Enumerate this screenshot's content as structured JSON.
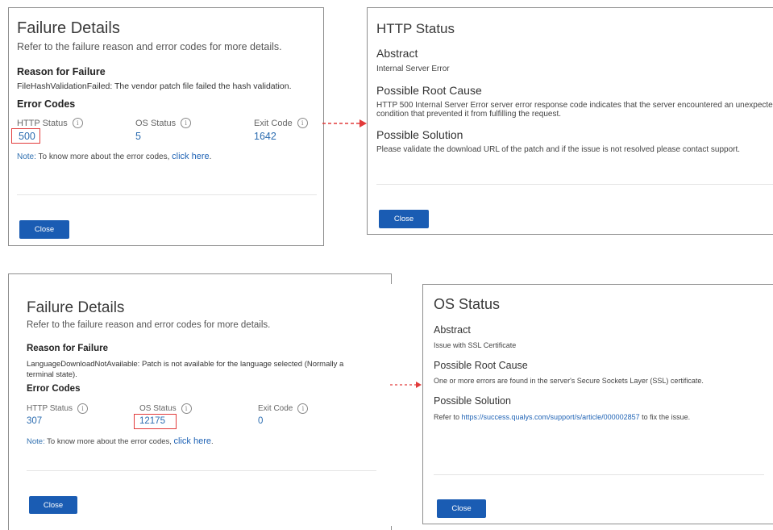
{
  "top_failure": {
    "title": "Failure Details",
    "subtitle": "Refer to the failure reason and error codes for more details.",
    "reason_heading": "Reason for Failure",
    "reason_text": "FileHashValidationFailed: The vendor patch file failed the hash validation.",
    "codes_heading": "Error Codes",
    "http_label": "HTTP Status",
    "http_value": "500",
    "os_label": "OS Status",
    "os_value": "5",
    "exit_label": "Exit Code",
    "exit_value": "1642",
    "note_label": "Note:",
    "note_text": " To know more about the error codes, ",
    "note_link": "click here",
    "note_end": ".",
    "close_label": "Close"
  },
  "http_status": {
    "title": "HTTP Status",
    "abstract_heading": "Abstract",
    "abstract_text": "Internal Server Error",
    "root_heading": "Possible Root Cause",
    "root_text_1": "HTTP 500 Internal Server Error server error response code indicates that the server encountered an unexpected",
    "root_text_2": "condition that prevented it from fulfilling the request.",
    "solution_heading": "Possible Solution",
    "solution_text": "Please validate the download URL of the patch and if the issue is not resolved please contact support.",
    "close_label": "Close"
  },
  "bottom_failure": {
    "title": "Failure Details",
    "subtitle": "Refer to the failure reason and error codes for more details.",
    "reason_heading": "Reason for Failure",
    "reason_text_1": "LanguageDownloadNotAvailable: Patch is not available for the language selected (Normally a",
    "reason_text_2": "terminal state).",
    "codes_heading": "Error Codes",
    "http_label": "HTTP Status",
    "http_value": "307",
    "os_label": "OS Status",
    "os_value": "12175",
    "exit_label": "Exit Code",
    "exit_value": "0",
    "note_label": "Note:",
    "note_text": " To know more about the error codes, ",
    "note_link": "click here",
    "note_end": ".",
    "close_label": "Close"
  },
  "os_status": {
    "title": "OS Status",
    "abstract_heading": "Abstract",
    "abstract_text": "Issue with SSL Certificate",
    "root_heading": "Possible Root Cause",
    "root_text": "One or more errors are found in the server's Secure Sockets Layer (SSL) certificate.",
    "solution_heading": "Possible Solution",
    "solution_prefix": "Refer to ",
    "solution_link": "https://success.qualys.com/support/s/article/000002857",
    "solution_suffix": " to fix the issue.",
    "close_label": "Close"
  },
  "icons": {
    "info": "i"
  },
  "colors": {
    "accent": "#1a5cb3",
    "link": "#1f63b5",
    "highlight": "#e23b3b"
  }
}
